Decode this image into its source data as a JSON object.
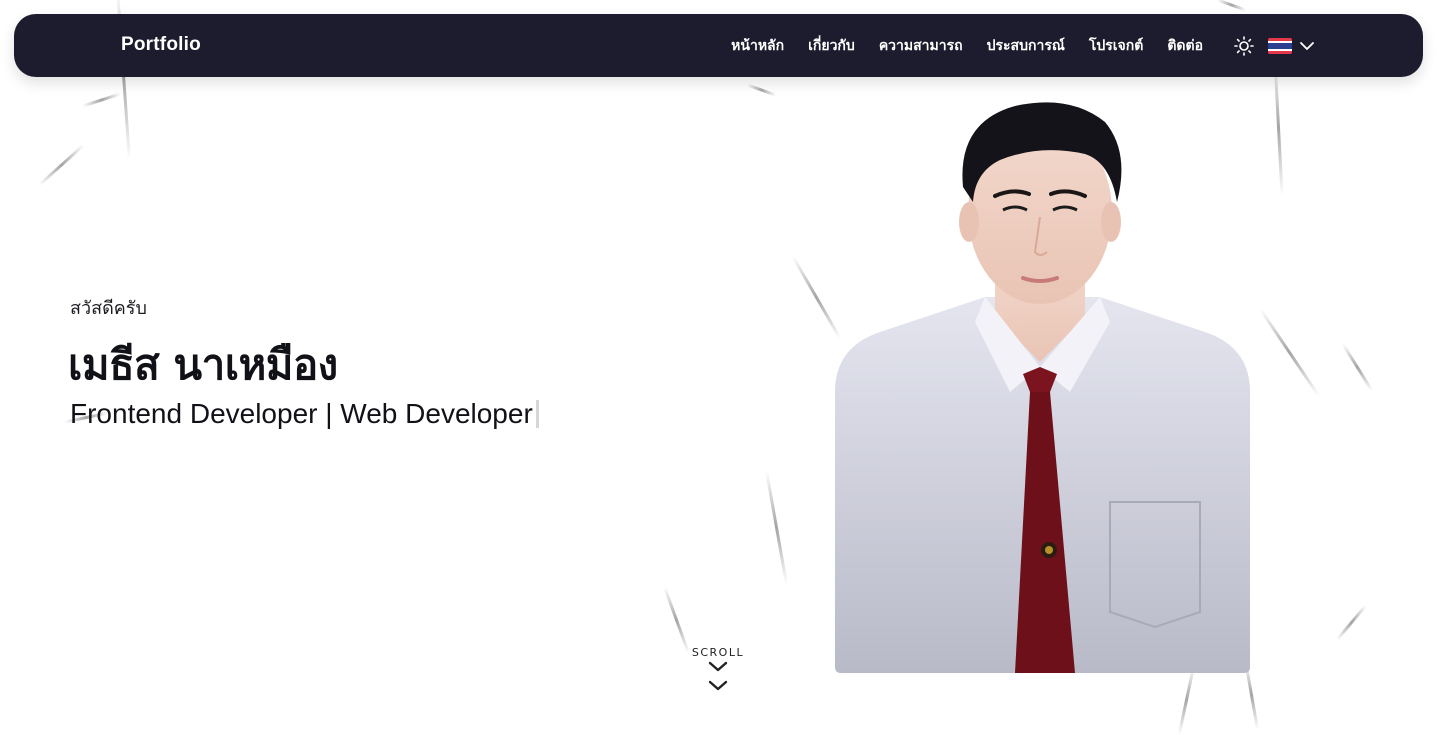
{
  "navbar": {
    "brand": "Portfolio",
    "links": [
      {
        "label": "หน้าหลัก"
      },
      {
        "label": "เกี่ยวกับ"
      },
      {
        "label": "ความสามารถ"
      },
      {
        "label": "ประสบการณ์"
      },
      {
        "label": "โปรเจกต์"
      },
      {
        "label": "ติดต่อ"
      }
    ],
    "theme_icon": "sun-icon",
    "language": {
      "flag": "thai-flag-icon",
      "chevron": "chevron-down-icon"
    }
  },
  "hero": {
    "greeting": "สวัสดีครับ",
    "name": "เมธีส นาเหมือง",
    "role": "Frontend Developer | Web Developer"
  },
  "scroll": {
    "label": "SCROLL",
    "icon": "double-chevron-down-icon"
  },
  "colors": {
    "navbar_bg": "#1d1c2e",
    "text_dark": "#111118",
    "tie": "#7c1420",
    "shirt": "#d8d9e6"
  }
}
